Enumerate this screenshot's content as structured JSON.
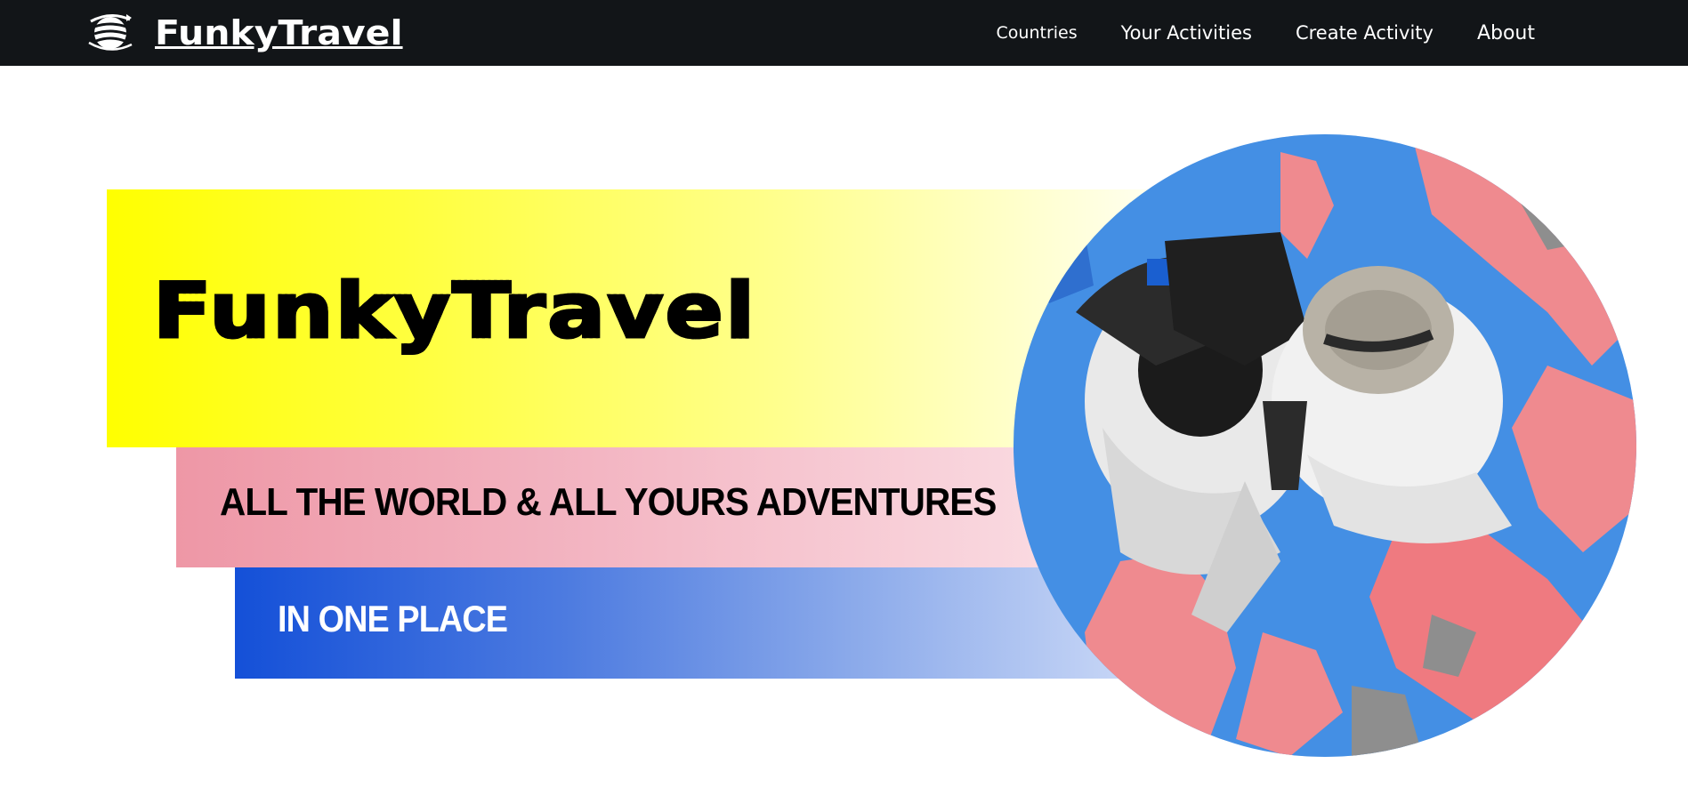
{
  "brand": {
    "name": "FunkyTravel",
    "logo_icon": "globe-icon"
  },
  "nav": {
    "items": [
      {
        "label": "Countries"
      },
      {
        "label": "Your Activities"
      },
      {
        "label": "Create Activity"
      },
      {
        "label": "About"
      }
    ]
  },
  "hero": {
    "title": "FunkyTravel",
    "subtitle": "ALL THE WORLD & ALL YOURS ADVENTURES",
    "tagline": "IN ONE PLACE",
    "photo_icon": "travelers-on-map-photo"
  },
  "colors": {
    "navbar": "#121518",
    "yellow_band": "#ffff00",
    "pink_band": "#ee97a6",
    "blue_band": "#1450d8",
    "map_ocean": "#3a86e0",
    "map_land": "#ef8a8f"
  }
}
